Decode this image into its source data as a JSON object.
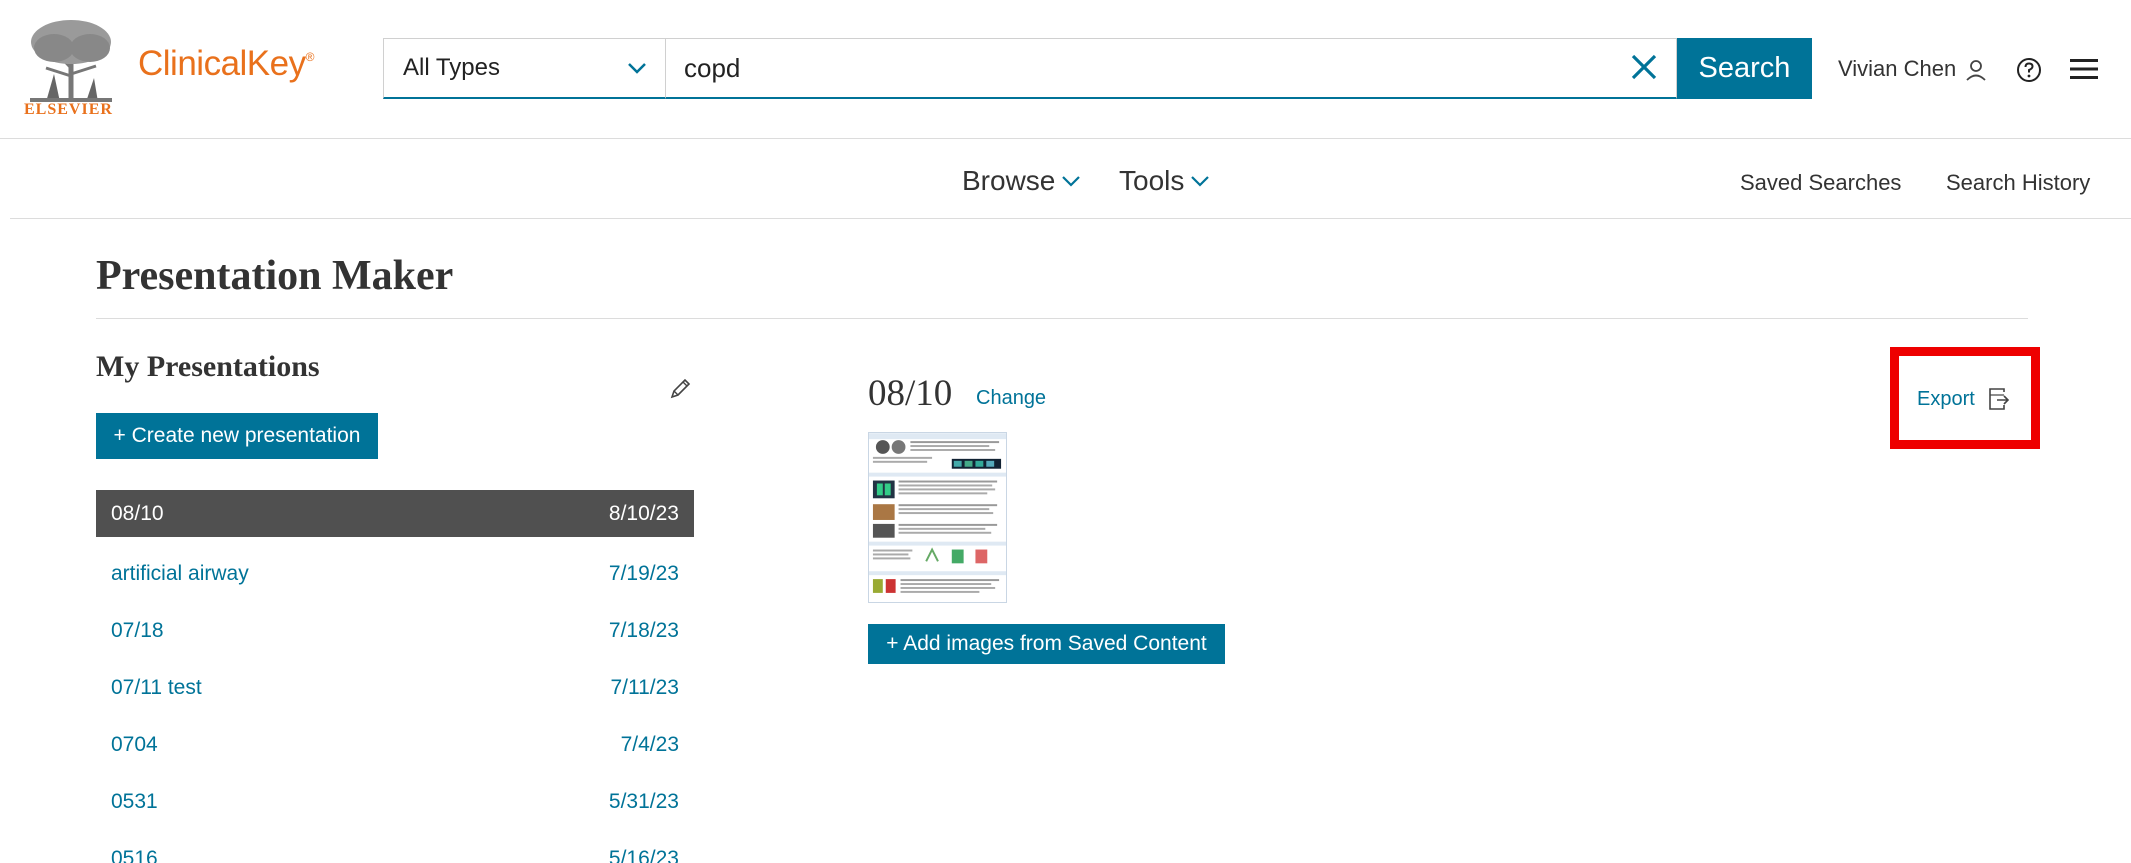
{
  "brand": {
    "publisher": "ELSEVIER",
    "product": "ClinicalKey",
    "trademark": "®",
    "accent_color": "#e9711c"
  },
  "search": {
    "type_selected": "All Types",
    "query": "copd",
    "button_label": "Search",
    "primary_color": "#007398"
  },
  "user": {
    "name": "Vivian Chen"
  },
  "nav": {
    "browse": "Browse",
    "tools": "Tools",
    "saved_searches": "Saved Searches",
    "search_history": "Search History"
  },
  "page": {
    "title": "Presentation Maker"
  },
  "sidebar": {
    "title": "My Presentations",
    "create_label": "+ Create new presentation",
    "items": [
      {
        "name": "08/10",
        "date": "8/10/23",
        "active": true
      },
      {
        "name": "artificial airway",
        "date": "7/19/23"
      },
      {
        "name": "07/18",
        "date": "7/18/23"
      },
      {
        "name": "07/11 test",
        "date": "7/11/23"
      },
      {
        "name": "0704",
        "date": "7/4/23"
      },
      {
        "name": "0531",
        "date": "5/31/23"
      },
      {
        "name": "0516",
        "date": "5/16/23"
      }
    ]
  },
  "current": {
    "title": "08/10",
    "change_label": "Change",
    "add_images_label": "+ Add images from Saved Content",
    "export_label": "Export",
    "highlight_color": "#ee0000"
  },
  "icons": [
    "elsevier-tree-icon",
    "chevron-down-icon",
    "clear-search-icon",
    "user-icon",
    "help-icon",
    "hamburger-menu-icon",
    "pencil-icon",
    "export-icon"
  ]
}
